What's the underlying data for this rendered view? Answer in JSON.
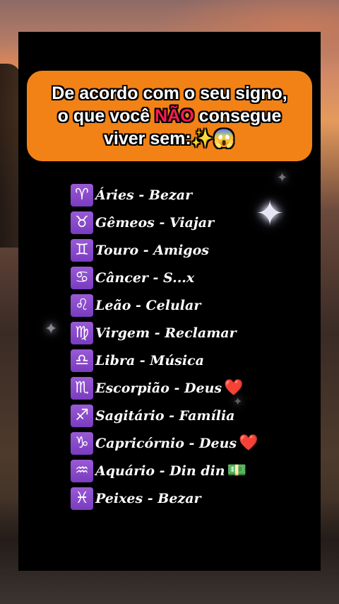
{
  "banner": {
    "line1": "De acordo com o seu signo,",
    "line2_before": "o que você ",
    "line2_highlight": "NÃO",
    "line2_after": " consegue",
    "line3_text": "viver sem:",
    "line3_emoji": "✨😱"
  },
  "colors": {
    "banner_bg": "#f28216",
    "highlight": "#ff1a52",
    "sign_box": "#8a4ccc"
  },
  "signs": [
    {
      "symbol": "♈",
      "icon": "aries-icon",
      "text": "Áries - Bezar",
      "emoji": "😘"
    },
    {
      "symbol": "♉",
      "icon": "taurus-icon",
      "text": "Gêmeos - Viajar",
      "emoji": ""
    },
    {
      "symbol": "♊",
      "icon": "gemini-icon",
      "text": "Touro - Amigos",
      "emoji": ""
    },
    {
      "symbol": "♋",
      "icon": "cancer-icon",
      "text": "Câncer - S...x",
      "emoji": "😈"
    },
    {
      "symbol": "♌",
      "icon": "leo-icon",
      "text": "Leão - Celular",
      "emoji": ""
    },
    {
      "symbol": "♍",
      "icon": "virgo-icon",
      "text": "Virgem - Reclamar",
      "emoji": ""
    },
    {
      "symbol": "♎",
      "icon": "libra-icon",
      "text": "Libra - Música",
      "emoji": ""
    },
    {
      "symbol": "♏",
      "icon": "scorpio-icon",
      "text": "Escorpião - Deus",
      "emoji": "❤️"
    },
    {
      "symbol": "♐",
      "icon": "sagittarius-icon",
      "text": "Sagitário - Família",
      "emoji": ""
    },
    {
      "symbol": "♑",
      "icon": "capricorn-icon",
      "text": "Capricórnio - Deus",
      "emoji": "❤️"
    },
    {
      "symbol": "♒",
      "icon": "aquarius-icon",
      "text": "Aquário - Din din",
      "emoji": "💵"
    },
    {
      "symbol": "♓",
      "icon": "pisces-icon",
      "text": "Peixes - Bezar",
      "emoji": "😘"
    }
  ]
}
